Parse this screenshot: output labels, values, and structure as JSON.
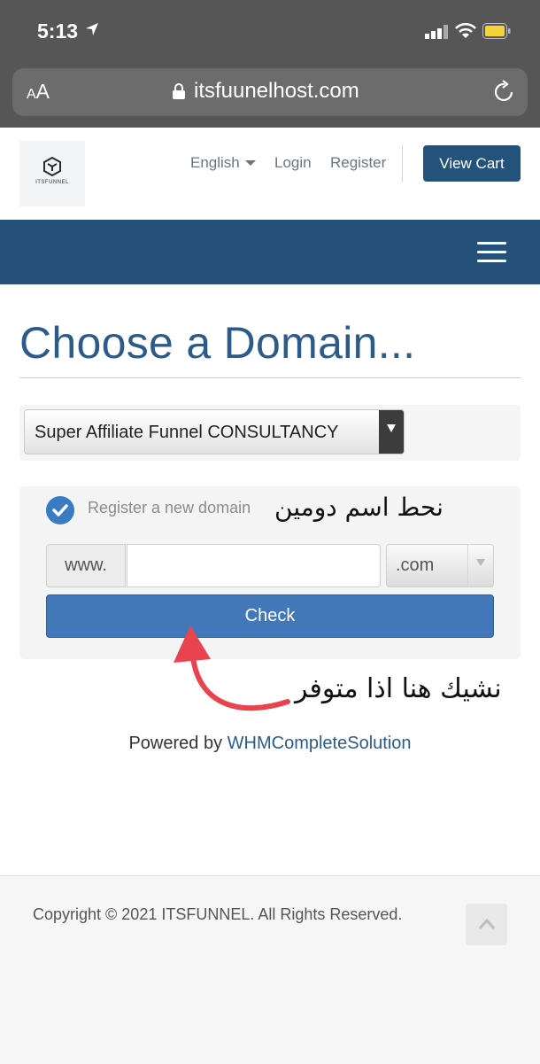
{
  "status_bar": {
    "time": "5:13"
  },
  "browser": {
    "text_size_label_small": "A",
    "text_size_label_large": "A",
    "url": "itsfuunelhost.com"
  },
  "header": {
    "logo_text": "ITSFUNNEL",
    "language_label": "English",
    "login_label": "Login",
    "register_label": "Register",
    "view_cart_label": "View Cart"
  },
  "main": {
    "title": "Choose a Domain...",
    "product_selected": "Super Affiliate Funnel CONSULTANCY",
    "register_option_label": "Register a new domain",
    "www_prefix": "www.",
    "domain_input_value": "",
    "tld_selected": ".com",
    "check_button_label": "Check",
    "powered_by_prefix": "Powered by",
    "powered_by_link": "WHMCompleteSolution"
  },
  "annotations": {
    "note_register": "نحط اسم دومين",
    "note_check": "نشيك هنا اذا متوفر",
    "arrow_color": "#e8444f"
  },
  "footer": {
    "copyright": "Copyright © 2021 ITSFUNNEL. All Rights Reserved."
  },
  "colors": {
    "brand_dark": "#24507a",
    "button_blue": "#4277b8",
    "title_blue": "#2c5b8a"
  }
}
